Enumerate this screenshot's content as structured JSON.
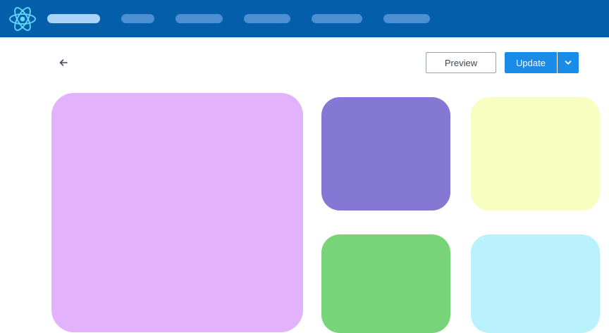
{
  "header": {
    "logo": "react-logo-icon",
    "nav_items": [
      {
        "name": "nav-item-1",
        "active": true
      },
      {
        "name": "nav-item-2",
        "active": false
      },
      {
        "name": "nav-item-3",
        "active": false
      },
      {
        "name": "nav-item-4",
        "active": false
      },
      {
        "name": "nav-item-5",
        "active": false
      },
      {
        "name": "nav-item-6",
        "active": false
      }
    ],
    "colors": {
      "bar": "#055ea9",
      "pill": "#4d8fd3",
      "pill_active": "#a9d4f8"
    }
  },
  "toolbar": {
    "back_icon": "arrow-left-icon",
    "preview_label": "Preview",
    "update_label": "Update",
    "dropdown_icon": "chevron-down-icon"
  },
  "tiles": [
    {
      "name": "tile-large",
      "color": "#e3b2fd"
    },
    {
      "name": "tile-purple",
      "color": "#8478d4"
    },
    {
      "name": "tile-yellow",
      "color": "#f8fdc0"
    },
    {
      "name": "tile-green",
      "color": "#78d479"
    },
    {
      "name": "tile-cyan",
      "color": "#b9f2fd"
    }
  ]
}
